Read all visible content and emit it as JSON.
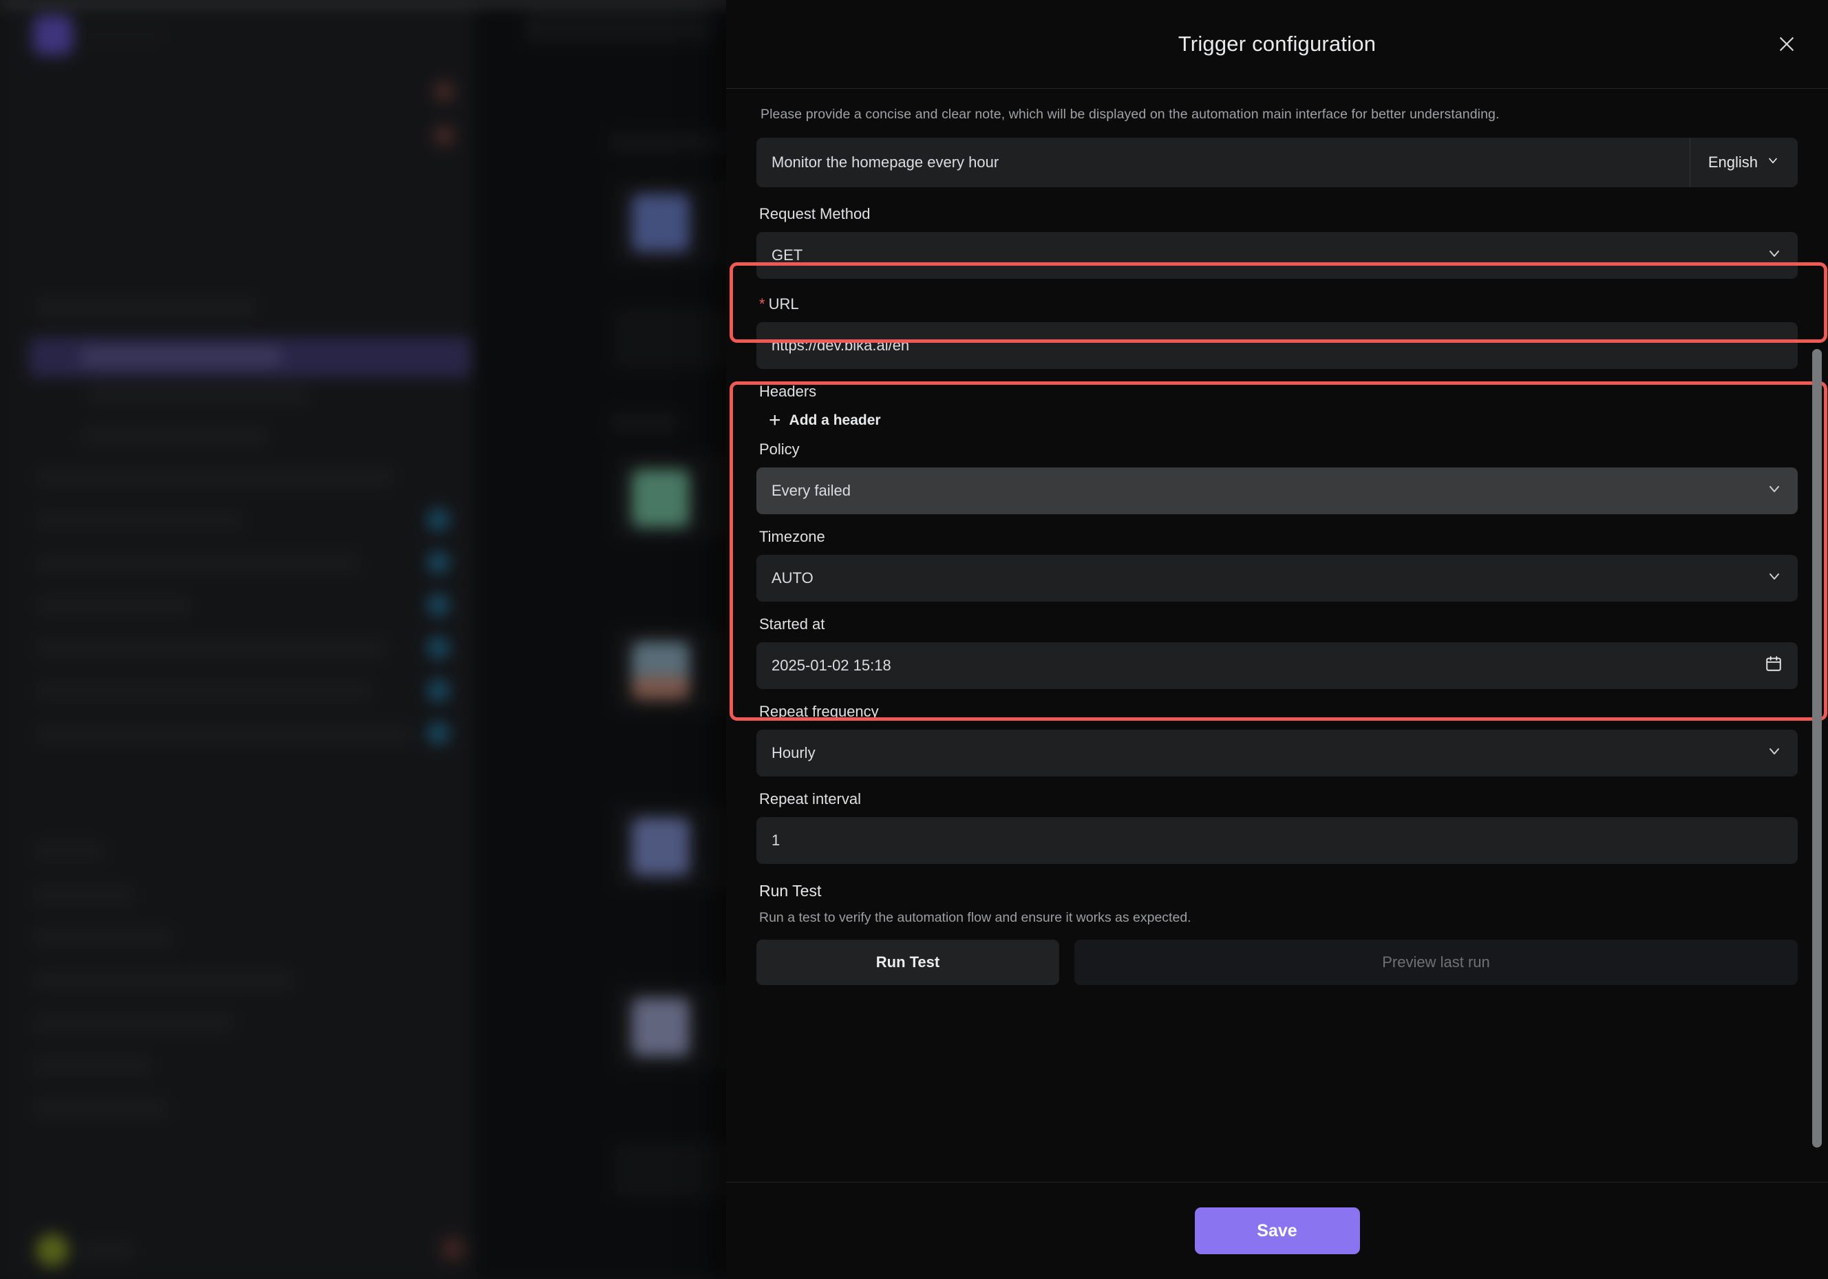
{
  "panel": {
    "title": "Trigger configuration",
    "close_icon": "close-icon",
    "hint": "Please provide a concise and clear note, which will be displayed on the automation main interface for better understanding.",
    "note": {
      "value": "Monitor the homepage every hour",
      "placeholder": "Monitor the homepage every hour",
      "language": "English",
      "language_chevron": "chevron-down-icon"
    },
    "request_method": {
      "label": "Request Method",
      "value": "GET",
      "chevron": "chevron-down-icon"
    },
    "url": {
      "label": "URL",
      "required_marker": "*",
      "value": "https://dev.bika.ai/en",
      "placeholder": "https://dev.bika.ai/en",
      "highlighted": true
    },
    "headers": {
      "label": "Headers",
      "add_label": "Add a header",
      "add_icon": "plus-icon"
    },
    "policy": {
      "label": "Policy",
      "value": "Every failed",
      "chevron": "chevron-down-icon"
    },
    "timezone": {
      "label": "Timezone",
      "value": "AUTO",
      "chevron": "chevron-down-icon"
    },
    "started_at": {
      "label": "Started at",
      "value": "2025-01-02 15:18",
      "icon": "calendar-icon"
    },
    "repeat_frequency": {
      "label": "Repeat frequency",
      "value": "Hourly",
      "chevron": "chevron-down-icon"
    },
    "repeat_interval": {
      "label": "Repeat interval",
      "value": "1",
      "placeholder": "1"
    },
    "run_test": {
      "title": "Run Test",
      "description": "Run a test to verify the automation flow and ensure it works as expected.",
      "run_button": "Run Test",
      "preview_button": "Preview last run"
    },
    "save_button": "Save"
  },
  "colors": {
    "accent": "#8b74f0",
    "highlight_ring": "#ef5b54",
    "required_marker": "#e85d57",
    "panel_bg": "#0b0b0c",
    "field_bg": "#1f2022",
    "field_bg_hover": "#3a3b3d",
    "muted_text": "#9fa1a4"
  }
}
